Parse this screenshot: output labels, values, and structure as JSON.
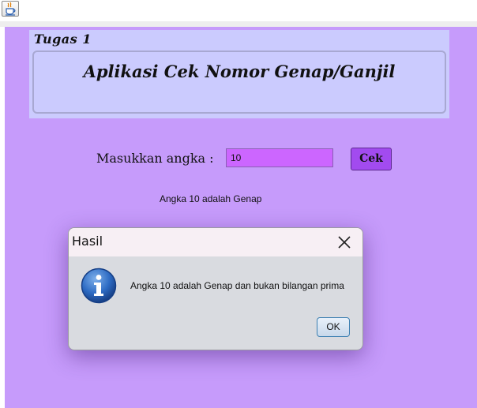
{
  "toolbar": {
    "icon": "java-cup-icon"
  },
  "header": {
    "tugas": "Tugas 1",
    "title": "Aplikasi Cek Nomor Genap/Ganjil"
  },
  "form": {
    "input_label": "Masukkan angka :",
    "input_value": "10",
    "button_label": "Cek",
    "result_text": "Angka 10 adalah Genap"
  },
  "dialog": {
    "title": "Hasil",
    "message": "Angka 10 adalah Genap dan bukan bilangan prima",
    "ok_label": "OK",
    "icon": "info-icon"
  },
  "colors": {
    "frame_bg": "#c69bfb",
    "header_bg": "#cbcbfe",
    "input_bg": "#cc66ff",
    "button_bg": "#a24bef"
  }
}
